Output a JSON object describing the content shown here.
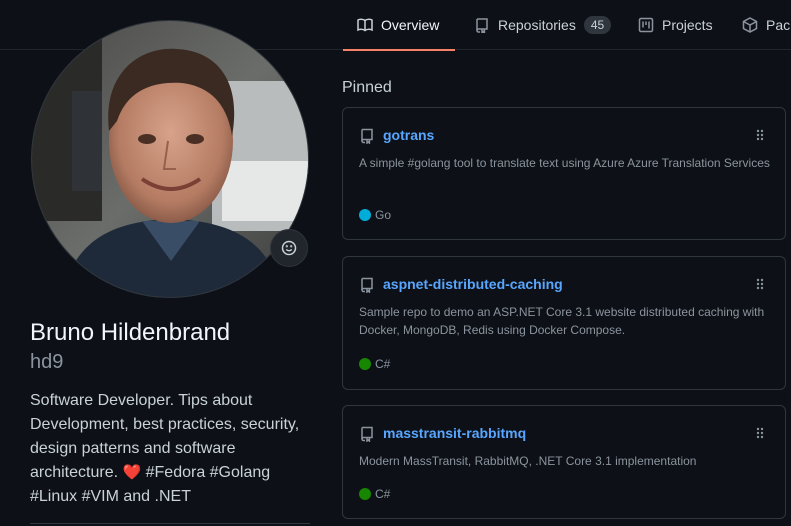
{
  "nav": {
    "tabs": [
      {
        "label": "Overview",
        "icon": "book-icon",
        "active": true
      },
      {
        "label": "Repositories",
        "icon": "repo-icon",
        "count": "45"
      },
      {
        "label": "Projects",
        "icon": "project-icon"
      },
      {
        "label": "Packages",
        "icon": "package-icon"
      }
    ]
  },
  "profile": {
    "fullname": "Bruno Hildenbrand",
    "login": "hd9",
    "bio_before_heart": "Software Developer. Tips about Development, best practices, security, design patterns and software architecture. ",
    "bio_heart": "❤️",
    "bio_after_heart": " #Fedora #Golang #Linux #VIM and .NET"
  },
  "pinned": {
    "title": "Pinned",
    "repos": [
      {
        "name": "gotrans",
        "description": "A simple #golang tool to translate text using Azure Azure Translation Services",
        "language": "Go",
        "language_color": "#00ADD8"
      },
      {
        "name": "aspnet-distributed-caching",
        "description": "Sample repo to demo an ASP.NET Core 3.1 website distributed caching with Docker, MongoDB, Redis using Docker Compose.",
        "language": "C#",
        "language_color": "#178600"
      },
      {
        "name": "masstransit-rabbitmq",
        "description": "Modern MassTransit, RabbitMQ, .NET Core 3.1 implementation",
        "language": "C#",
        "language_color": "#178600"
      }
    ]
  },
  "colors": {
    "accent": "#f78166",
    "link": "#58a6ff",
    "background": "#0d1117",
    "border": "#30363d"
  }
}
